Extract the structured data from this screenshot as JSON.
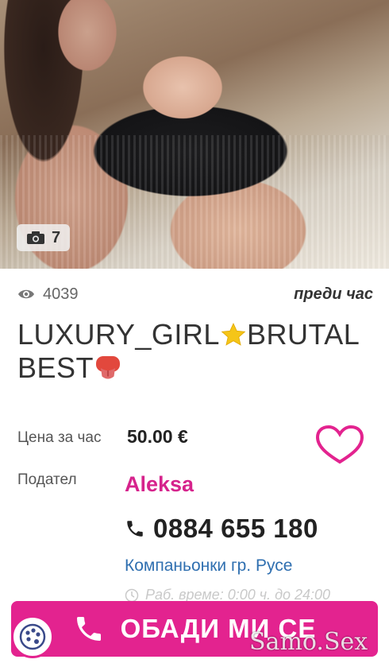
{
  "listing": {
    "photo_count": "7",
    "views": "4039",
    "posted": "преди час",
    "title_line1": "LUXURY_GIRL",
    "title_line1b": "BRUTAL",
    "title_line2": "BEST",
    "price_label": "Цена за час",
    "price_value": "50.00 €",
    "provider_label": "Подател",
    "provider_name": "Aleksa",
    "phone": "0884 655 180",
    "category": "Компаньонки гр. Русе",
    "hours": "Раб. време: 0:00 ч. до 24:00"
  },
  "actions": {
    "call_label": "ОБАДИ МИ СЕ"
  },
  "watermark": "Samo.Sex",
  "colors": {
    "accent": "#e3238f",
    "link": "#2f6fb0"
  },
  "icons": {
    "camera": "camera-icon",
    "eye": "eye-icon",
    "heart": "heart-icon",
    "phone": "phone-icon",
    "clock": "clock-icon"
  }
}
